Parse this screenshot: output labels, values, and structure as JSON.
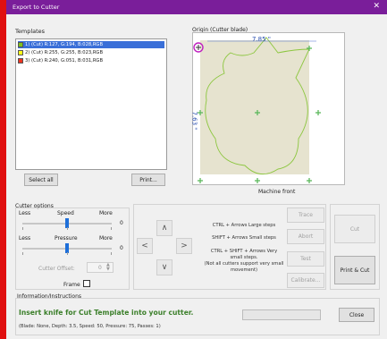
{
  "window": {
    "title": "Export to Cutter",
    "close_glyph": "✕"
  },
  "templates": {
    "label": "Templates",
    "items": [
      {
        "label": "1) (Cut) R:127, G:194, B:028,RGB",
        "color": "#7fc21c",
        "selected": true
      },
      {
        "label": "2) (Cut) R:255, G:255, B:023,RGB",
        "color": "#ffff17",
        "selected": false
      },
      {
        "label": "3) (Cut) R:240, G:051, B:031,RGB",
        "color": "#f0331f",
        "selected": false
      }
    ],
    "select_all_label": "Select all",
    "print_label": "Print..."
  },
  "preview": {
    "origin_label": "Origin (Cutter blade)",
    "width_label": "7.85 \"",
    "height_label": "7.63 \"",
    "machine_front_label": "Machine front",
    "shape_fill": "#e6e3cf",
    "shape_stroke": "#8cc63f",
    "marker_color": "#8bc34a",
    "origin_color": "#c020c0"
  },
  "cutter_options": {
    "label": "Cutter options",
    "speed": {
      "label": "Speed",
      "less": "Less",
      "more": "More",
      "value": "0"
    },
    "pressure": {
      "label": "Pressure",
      "less": "Less",
      "more": "More",
      "value": "0"
    },
    "offset": {
      "label": "Cutter Offset:",
      "value": "0"
    },
    "frame_label": "Frame"
  },
  "moves": {
    "up": "∧",
    "down": "∨",
    "left": "<",
    "right": ">",
    "hint1": "CTRL + Arrows  Large steps",
    "hint2": "SHIFT + Arrows  Small steps",
    "hint3_a": "CTRL + SHIFT + Arrows  Very",
    "hint3_b": "small steps.",
    "hint3_c": "(Not all cutters support very small",
    "hint3_d": "movement)"
  },
  "actions": {
    "trace": "Trace",
    "abort": "Abort",
    "test": "Test",
    "calibrate": "Calibrate...",
    "cut": "Cut",
    "print_cut": "Print & Cut"
  },
  "info": {
    "label": "Information/Instructions",
    "message": "Insert knife for Cut Template into your cutter.",
    "details": "(Blade: None, Depth: 3.5, Speed: 50, Pressure: 75, Passes: 1)",
    "close_label": "Close"
  }
}
